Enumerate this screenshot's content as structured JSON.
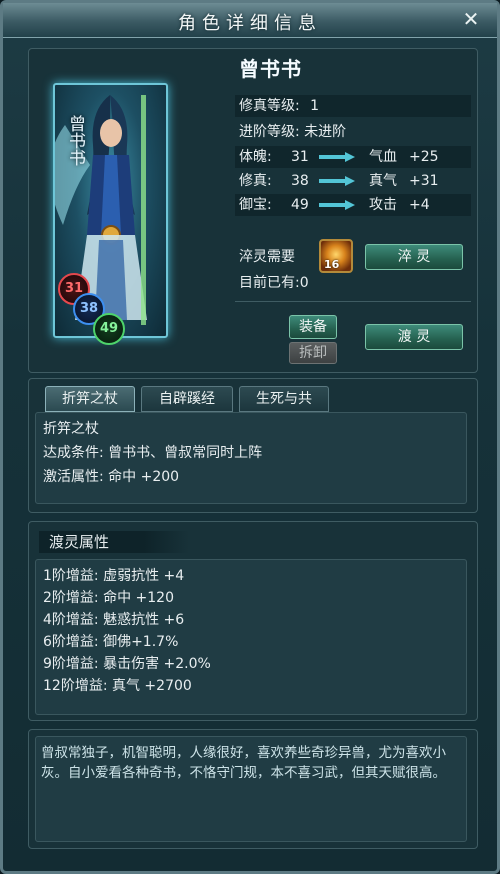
{
  "window": {
    "title": "角色详细信息",
    "close_symbol": "✕"
  },
  "character": {
    "name": "曾书书",
    "portrait_name": "曾书书",
    "orbs": [
      "31",
      "38",
      "49"
    ],
    "cultivation_level_label": "修真等级:",
    "cultivation_level_value": "1",
    "advance_level_label": "进阶等级:",
    "advance_level_value": "未进阶",
    "stats": [
      {
        "label": "体魄:",
        "value": "31",
        "bonus_label": "气血",
        "bonus_value": "+25"
      },
      {
        "label": "修真:",
        "value": "38",
        "bonus_label": "真气",
        "bonus_value": "+31"
      },
      {
        "label": "御宝:",
        "value": "49",
        "bonus_label": "攻击",
        "bonus_value": "+4"
      }
    ],
    "refine_need_label": "淬灵需要",
    "refine_item_count": "16",
    "owned_text": "目前已有:0"
  },
  "buttons": {
    "refine": "淬 灵",
    "equip": "装备",
    "unequip": "拆卸",
    "ferry": "渡 灵"
  },
  "tabs": [
    "折笄之杖",
    "自辟蹊经",
    "生死与共"
  ],
  "bond": {
    "name": "折笄之杖",
    "condition": "达成条件: 曾书书、曾叔常同时上阵",
    "attribute": "激活属性: 命中 +200"
  },
  "ferry_section": {
    "title": "渡灵属性",
    "lines": [
      "1阶增益: 虚弱抗性 +4",
      "2阶增益: 命中 +120",
      "4阶增益: 魅惑抗性 +6",
      "6阶增益: 御佛+1.7%",
      "9阶增益: 暴击伤害 +2.0%",
      "12阶增益: 真气 +2700"
    ]
  },
  "description": "曾叔常独子，机智聪明，人缘很好，喜欢养些奇珍异兽，尤为喜欢小灰。自小爱看各种奇书，不恪守门规，本不喜习武，但其天赋很高。",
  "colors": {
    "accent_green": "#3e8b7a",
    "arrow_teal": "#53c5d6",
    "orb_red": "#e5484d",
    "orb_blue": "#3d8ff0",
    "orb_green": "#4ed36b"
  }
}
